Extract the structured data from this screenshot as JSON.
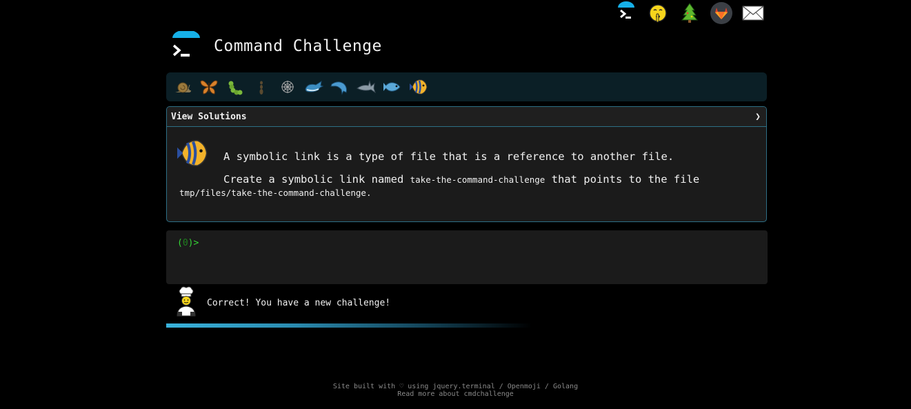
{
  "app": {
    "title": "Command Challenge"
  },
  "top_icons": [
    {
      "name": "cmdchallenge-logo-icon"
    },
    {
      "name": "shushing-face-icon"
    },
    {
      "name": "christmas-tree-icon"
    },
    {
      "name": "gitlab-icon"
    },
    {
      "name": "envelope-icon"
    }
  ],
  "emoji_bar": [
    {
      "name": "snail-icon"
    },
    {
      "name": "butterfly-icon"
    },
    {
      "name": "caterpillar-icon"
    },
    {
      "name": "ant-icon"
    },
    {
      "name": "spider-web-icon"
    },
    {
      "name": "whale-icon"
    },
    {
      "name": "dolphin-icon"
    },
    {
      "name": "shark-icon"
    },
    {
      "name": "fish-icon"
    },
    {
      "name": "tropical-fish-icon"
    }
  ],
  "solutions": {
    "label": "View Solutions",
    "chevron": "❯"
  },
  "challenge": {
    "line1": "A symbolic link is a type of file that is a reference to another file.",
    "line2_pre": "Create a symbolic link named ",
    "line2_code": "take-the-command-challenge",
    "line2_post": " that points to the file",
    "line3_code": "tmp/files/take-the-command-challenge",
    "line3_post": "."
  },
  "terminal": {
    "prompt_open": "(",
    "prompt_num": "0",
    "prompt_close": ")>"
  },
  "status": {
    "message": "Correct! You have a new challenge!"
  },
  "progress": {
    "fraction": 0.6
  },
  "footer": {
    "line1_pre": "Site built with ",
    "heart": "♡",
    "line1_post": " using jquery.terminal / Openmoji / Golang",
    "line2": "Read more about cmdchallenge"
  },
  "colors": {
    "accent": "#39b3dc",
    "prompt_green": "#35d435",
    "panel_border": "#2d6f86"
  }
}
